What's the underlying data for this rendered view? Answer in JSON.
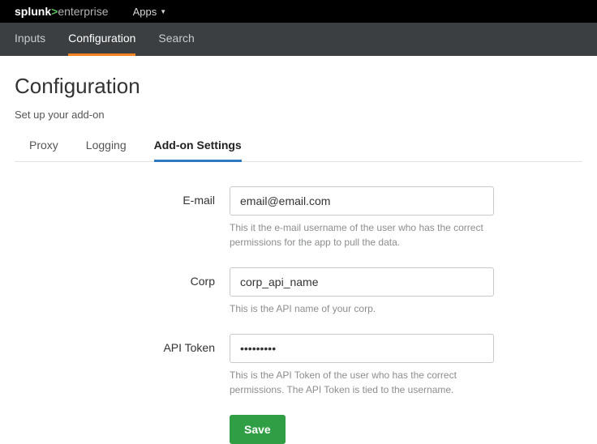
{
  "topbar": {
    "logo_primary": "splunk",
    "logo_secondary": "enterprise",
    "apps_label": "Apps"
  },
  "nav": {
    "items": [
      {
        "label": "Inputs",
        "active": false
      },
      {
        "label": "Configuration",
        "active": true
      },
      {
        "label": "Search",
        "active": false
      }
    ]
  },
  "page": {
    "title": "Configuration",
    "subtitle": "Set up your add-on"
  },
  "subtabs": {
    "items": [
      {
        "label": "Proxy",
        "active": false
      },
      {
        "label": "Logging",
        "active": false
      },
      {
        "label": "Add-on Settings",
        "active": true
      }
    ]
  },
  "form": {
    "email": {
      "label": "E-mail",
      "value": "email@email.com",
      "help": "This it the e-mail username of the user who has the correct permissions for the app to pull the data."
    },
    "corp": {
      "label": "Corp",
      "value": "corp_api_name",
      "help": "This is the API name of your corp."
    },
    "token": {
      "label": "API Token",
      "value": "•••••••••",
      "help": "This is the API Token of the user who has the correct permissions. The API Token is tied to the username."
    },
    "save_label": "Save"
  }
}
